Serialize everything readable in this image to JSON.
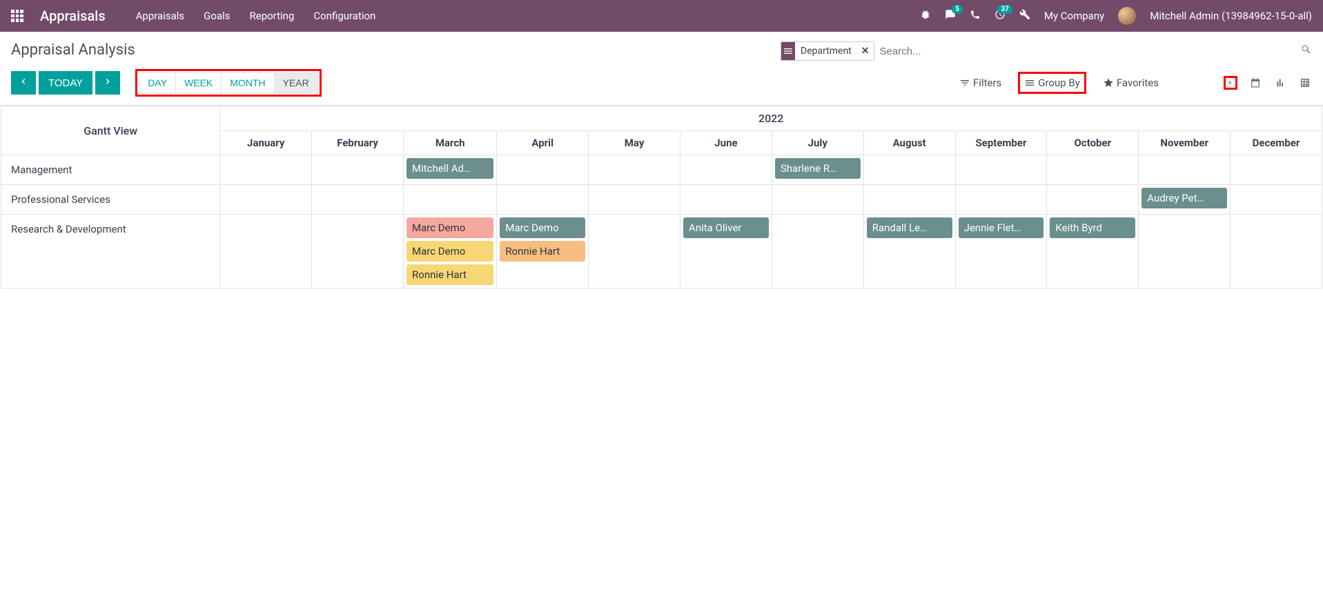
{
  "navbar": {
    "app_title": "Appraisals",
    "menu": [
      "Appraisals",
      "Goals",
      "Reporting",
      "Configuration"
    ],
    "msg_badge": "5",
    "activity_badge": "37",
    "company": "My Company",
    "user": "Mitchell Admin (13984962-15-0-all)"
  },
  "header": {
    "page_title": "Appraisal Analysis",
    "facet_label": "Department",
    "search_placeholder": "Search..."
  },
  "toolbar": {
    "today": "TODAY",
    "scales": [
      "DAY",
      "WEEK",
      "MONTH",
      "YEAR"
    ],
    "active_scale": "YEAR",
    "filters": "Filters",
    "group_by": "Group By",
    "favorites": "Favorites"
  },
  "gantt": {
    "view_label": "Gantt View",
    "year": "2022",
    "months": [
      "January",
      "February",
      "March",
      "April",
      "May",
      "June",
      "July",
      "August",
      "September",
      "October",
      "November",
      "December"
    ],
    "rows": [
      {
        "label": "Management",
        "cells": {
          "March": [
            {
              "text": "Mitchell Ad…",
              "color": "teal"
            }
          ],
          "July": [
            {
              "text": "Sharlene R…",
              "color": "teal"
            }
          ]
        }
      },
      {
        "label": "Professional Services",
        "cells": {
          "November": [
            {
              "text": "Audrey Pet…",
              "color": "teal"
            }
          ]
        }
      },
      {
        "label": "Research & Development",
        "cells": {
          "March": [
            {
              "text": "Marc Demo",
              "color": "red"
            },
            {
              "text": "Marc Demo",
              "color": "yellow"
            },
            {
              "text": "Ronnie Hart",
              "color": "yellow"
            }
          ],
          "April": [
            {
              "text": "Marc Demo",
              "color": "teal"
            },
            {
              "text": "Ronnie Hart",
              "color": "orange"
            }
          ],
          "June": [
            {
              "text": "Anita Oliver",
              "color": "teal"
            }
          ],
          "August": [
            {
              "text": "Randall Le…",
              "color": "teal"
            }
          ],
          "September": [
            {
              "text": "Jennie Flet…",
              "color": "teal"
            }
          ],
          "October": [
            {
              "text": "Keith Byrd",
              "color": "teal"
            }
          ]
        }
      }
    ]
  }
}
